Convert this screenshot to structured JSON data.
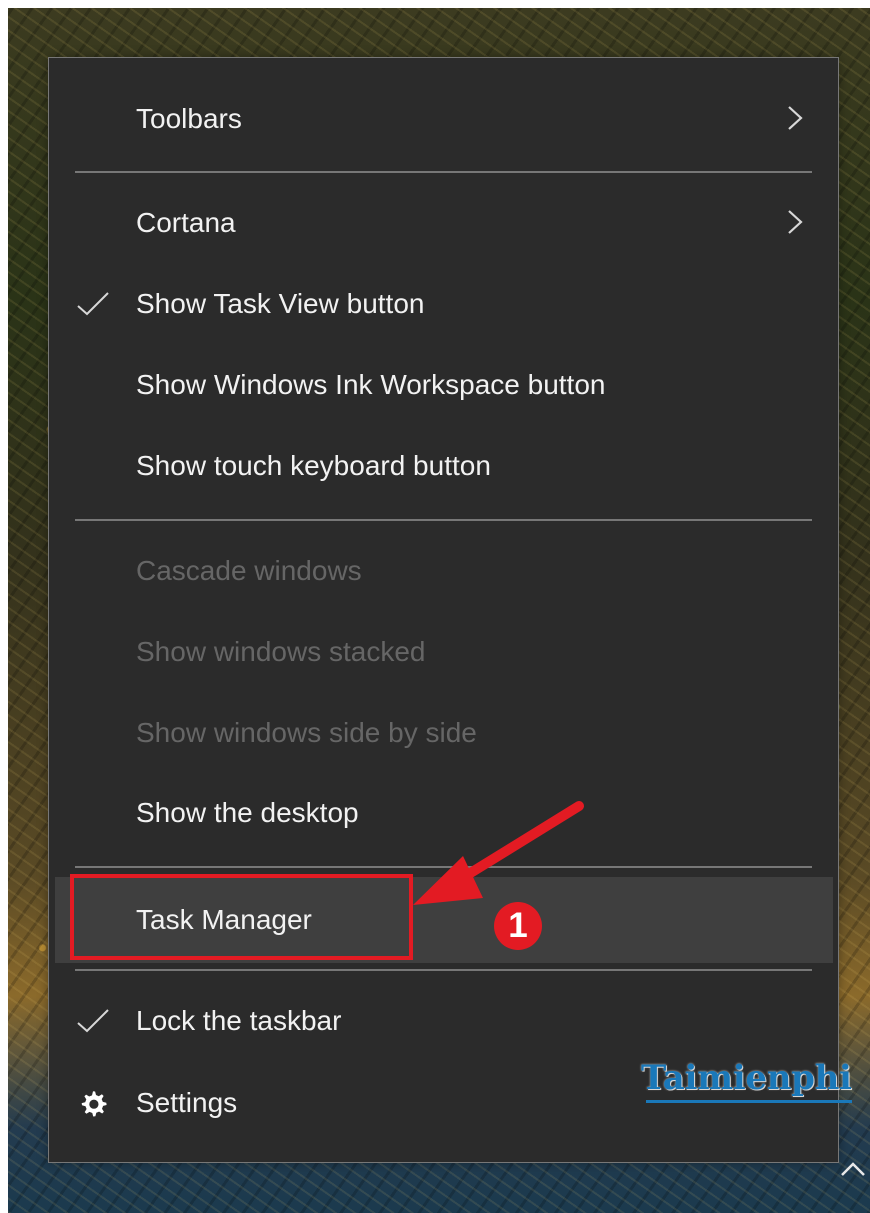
{
  "taskbar_context_menu": {
    "items": [
      {
        "id": "toolbars",
        "label": "Toolbars",
        "state": "enabled",
        "submenu": true
      },
      {
        "id": "cortana",
        "label": "Cortana",
        "state": "enabled",
        "submenu": true
      },
      {
        "id": "task-view",
        "label": "Show Task View button",
        "state": "enabled",
        "checked": true
      },
      {
        "id": "ink-workspace",
        "label": "Show Windows Ink Workspace button",
        "state": "enabled"
      },
      {
        "id": "touch-keyboard",
        "label": "Show touch keyboard button",
        "state": "enabled"
      },
      {
        "id": "cascade",
        "label": "Cascade windows",
        "state": "disabled"
      },
      {
        "id": "stacked",
        "label": "Show windows stacked",
        "state": "disabled"
      },
      {
        "id": "side-by-side",
        "label": "Show windows side by side",
        "state": "disabled"
      },
      {
        "id": "desktop",
        "label": "Show the desktop",
        "state": "enabled"
      },
      {
        "id": "task-manager",
        "label": "Task Manager",
        "state": "highlighted"
      },
      {
        "id": "lock-taskbar",
        "label": "Lock the taskbar",
        "state": "enabled",
        "checked": true
      },
      {
        "id": "settings",
        "label": "Settings",
        "state": "enabled",
        "icon": "gear-icon"
      }
    ]
  },
  "annotation": {
    "step_number": "1",
    "highlight_color": "#e31b23"
  },
  "watermark": {
    "text": "Taimienphi"
  },
  "icons": {
    "submenu": "chevron-right-icon",
    "checked": "check-icon",
    "settings": "gear-icon",
    "tray": "chevron-up-icon"
  },
  "colors": {
    "menu_background": "#2b2b2b",
    "menu_text": "#f2f2f2",
    "disabled_text": "#666666",
    "highlight_background": "#3f3f3f",
    "separator": "#777777",
    "watermark": "#1a78b9"
  }
}
